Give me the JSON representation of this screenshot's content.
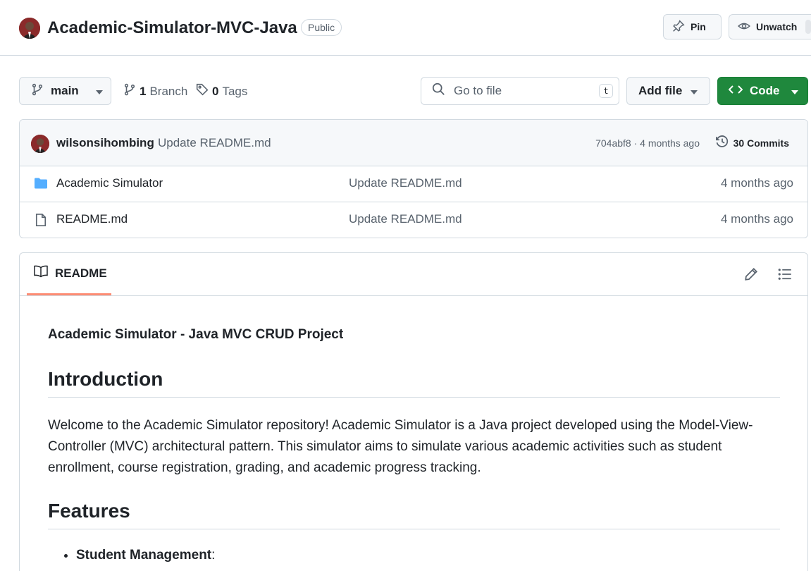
{
  "repo": {
    "name": "Academic-Simulator-MVC-Java",
    "visibility": "Public"
  },
  "header_actions": {
    "pin_label": "Pin",
    "unwatch_label": "Unwatch"
  },
  "toolbar": {
    "branch": "main",
    "branch_count": "1",
    "branch_word": "Branch",
    "tag_count": "0",
    "tag_word": "Tags",
    "search_placeholder": "Go to file",
    "search_shortcut": "t",
    "add_file_label": "Add file",
    "code_label": "Code"
  },
  "latest_commit": {
    "author": "wilsonsihombing",
    "message": "Update README.md",
    "hash_and_age": "704abf8 · 4 months ago",
    "commits_label": "30 Commits"
  },
  "files": [
    {
      "name": "Academic Simulator",
      "type": "folder",
      "commit": "Update README.md",
      "age": "4 months ago"
    },
    {
      "name": "README.md",
      "type": "file",
      "commit": "Update README.md",
      "age": "4 months ago"
    }
  ],
  "readme": {
    "tab_label": "README",
    "doc_title": "Academic Simulator - Java MVC CRUD Project",
    "intro_heading": "Introduction",
    "intro_text": "Welcome to the Academic Simulator repository! Academic Simulator is a Java project developed using the Model-View-Controller (MVC) architectural pattern. This simulator aims to simulate various academic activities such as student enrollment, course registration, grading, and academic progress tracking.",
    "features_heading": "Features",
    "feature_items": [
      {
        "label": "Student Management",
        "suffix": ":"
      }
    ]
  },
  "colors": {
    "primary_green": "#1f883d",
    "folder_blue": "#54aeff",
    "tab_underline": "#fd8c73",
    "border": "#d1d9e0",
    "muted_text": "#59636e"
  }
}
